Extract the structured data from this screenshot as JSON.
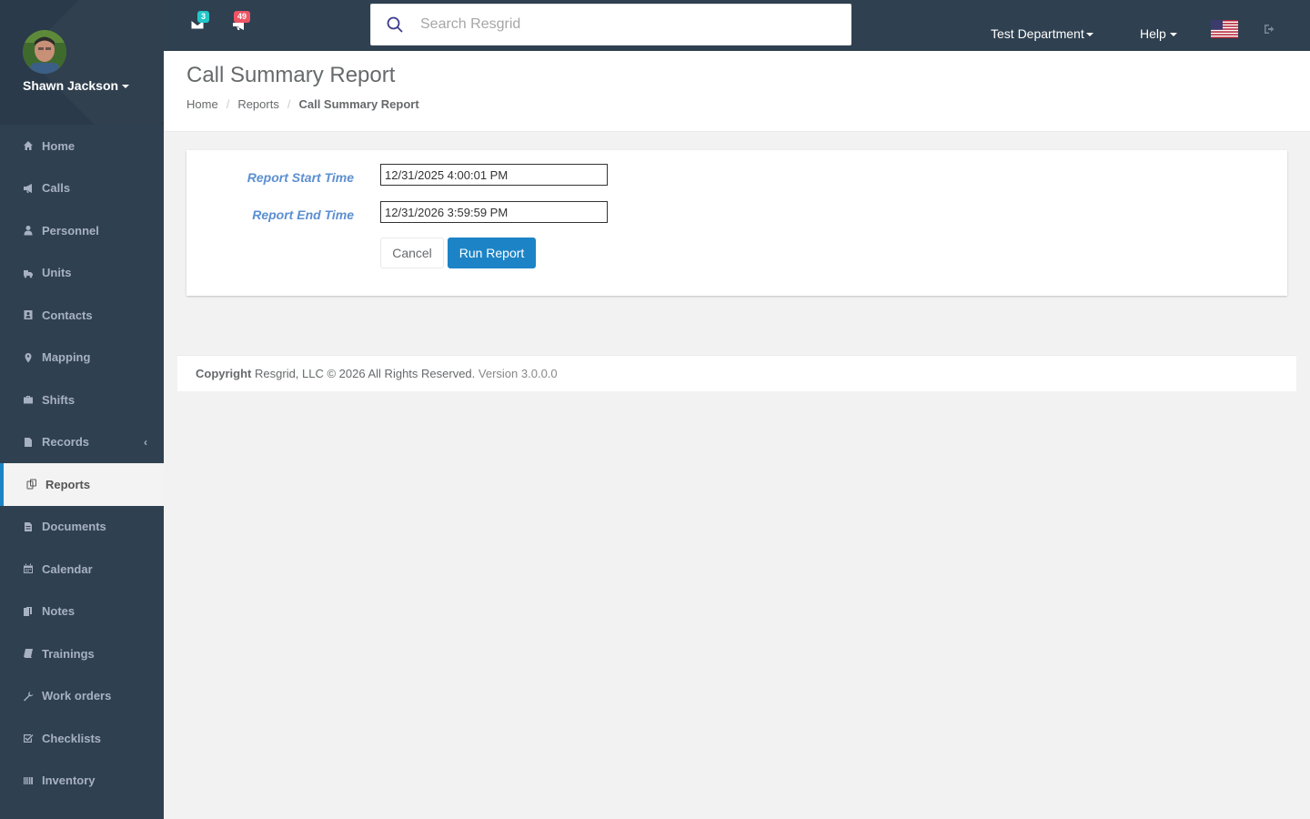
{
  "user": {
    "name": "Shawn Jackson"
  },
  "sidebar": {
    "items": [
      {
        "label": "Home",
        "icon": "home-icon"
      },
      {
        "label": "Calls",
        "icon": "bullhorn-icon"
      },
      {
        "label": "Personnel",
        "icon": "user-icon"
      },
      {
        "label": "Units",
        "icon": "truck-icon"
      },
      {
        "label": "Contacts",
        "icon": "contact-card-icon"
      },
      {
        "label": "Mapping",
        "icon": "map-marker-icon"
      },
      {
        "label": "Shifts",
        "icon": "briefcase-icon"
      },
      {
        "label": "Records",
        "icon": "file-icon",
        "chevron": "‹"
      },
      {
        "label": "Reports",
        "icon": "reports-icon",
        "active": true
      },
      {
        "label": "Documents",
        "icon": "document-icon"
      },
      {
        "label": "Calendar",
        "icon": "calendar-icon"
      },
      {
        "label": "Notes",
        "icon": "notes-icon"
      },
      {
        "label": "Trainings",
        "icon": "book-icon"
      },
      {
        "label": "Work orders",
        "icon": "wrench-icon"
      },
      {
        "label": "Checklists",
        "icon": "checkbox-icon"
      },
      {
        "label": "Inventory",
        "icon": "barcode-icon"
      }
    ]
  },
  "topbar": {
    "messages_count": "3",
    "calls_count": "49",
    "search_placeholder": "Search Resgrid",
    "department": "Test Department",
    "help": "Help"
  },
  "page": {
    "title": "Call Summary Report",
    "breadcrumb": {
      "home": "Home",
      "reports": "Reports",
      "current": "Call Summary Report"
    }
  },
  "form": {
    "start_label": "Report Start Time",
    "start_value": "12/31/2025 4:00:01 PM",
    "end_label": "Report End Time",
    "end_value": "12/31/2026 3:59:59 PM",
    "cancel_label": "Cancel",
    "run_label": "Run Report"
  },
  "footer": {
    "copyright_label": "Copyright",
    "copyright_text": "Resgrid, LLC © 2026 All Rights Reserved.",
    "version": "Version 3.0.0.0"
  },
  "colors": {
    "sidebar": "#2f4050",
    "accent": "#1c84c6",
    "label": "#5c8fd1"
  }
}
